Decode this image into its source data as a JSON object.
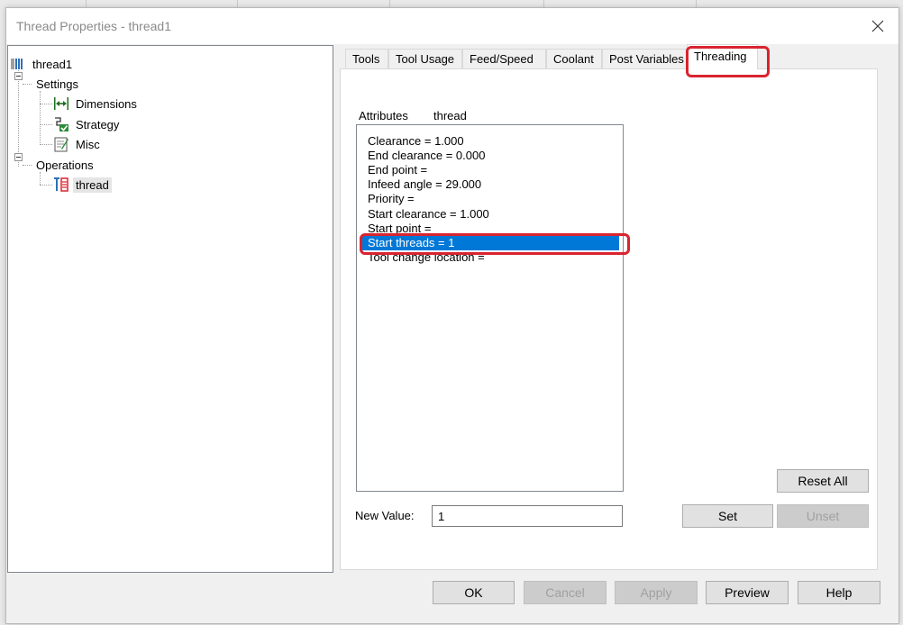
{
  "window": {
    "title": "Thread Properties - thread1",
    "close_icon": "close-icon"
  },
  "tree": {
    "root": {
      "label": "thread1",
      "icon": "thread-tool-icon"
    },
    "settings": {
      "label": "Settings",
      "children": [
        {
          "label": "Dimensions",
          "icon": "dimensions-icon"
        },
        {
          "label": "Strategy",
          "icon": "strategy-icon"
        },
        {
          "label": "Misc",
          "icon": "misc-icon"
        }
      ]
    },
    "operations": {
      "label": "Operations",
      "children": [
        {
          "label": "thread",
          "icon": "thread-operation-icon"
        }
      ]
    }
  },
  "tabs": [
    {
      "label": "Tools",
      "active": false
    },
    {
      "label": "Tool Usage",
      "active": false
    },
    {
      "label": "Feed/Speed",
      "active": false
    },
    {
      "label": "Coolant",
      "active": false
    },
    {
      "label": "Post Variables",
      "active": false
    },
    {
      "label": "Threading",
      "active": true
    }
  ],
  "threading": {
    "attributes_label": "Attributes",
    "attributes_value": "thread",
    "items": [
      "Clearance = 1.000",
      "End clearance = 0.000",
      "End point =",
      "Infeed angle = 29.000",
      "Priority =",
      "Start clearance = 1.000",
      "Start point =",
      "Start threads = 1",
      "Tool change location ="
    ],
    "selected_index": 7,
    "new_value_label": "New Value:",
    "new_value": "1",
    "reset_all_label": "Reset All",
    "set_label": "Set",
    "unset_label": "Unset"
  },
  "footer": {
    "ok_label": "OK",
    "cancel_label": "Cancel",
    "apply_label": "Apply",
    "preview_label": "Preview",
    "help_label": "Help"
  },
  "colors": {
    "selection": "#0078d7",
    "annotation": "#d9242f"
  }
}
